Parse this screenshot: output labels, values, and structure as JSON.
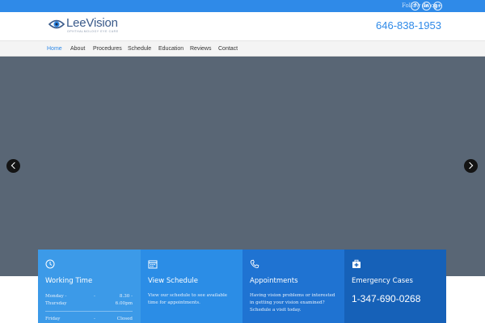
{
  "topbar": {
    "follow_label": "Follow us on:",
    "social": [
      {
        "icon": "facebook-icon",
        "glyph": "f"
      },
      {
        "icon": "linkedin-icon",
        "glyph": "in"
      },
      {
        "icon": "googleplus-icon",
        "glyph": "g+"
      }
    ]
  },
  "header": {
    "logo_name": "LeeVision",
    "logo_tagline": "OPHTHALMOLOGY EYE CARE",
    "phone": "646-838-1953"
  },
  "nav": {
    "items": [
      {
        "label": "Home",
        "active": true
      },
      {
        "label": "About"
      },
      {
        "label": "Procedures"
      },
      {
        "label": "Schedule"
      },
      {
        "label": "Education"
      },
      {
        "label": "Reviews"
      },
      {
        "label": "Contact"
      }
    ]
  },
  "slider": {
    "prev_icon": "chevron-left-icon",
    "next_icon": "chevron-right-icon"
  },
  "boxes": {
    "working_time": {
      "icon": "clock-icon",
      "title": "Working Time",
      "rows": [
        {
          "day": "Monday - Thursday",
          "dash": "-",
          "hours": "8.30 - 6.00pm"
        },
        {
          "day": "Friday",
          "dash": "-",
          "hours": "Closed"
        }
      ]
    },
    "schedule": {
      "icon": "calendar-icon",
      "title": "View Schedule",
      "desc": "View our schedule to see available time for appointments."
    },
    "appointments": {
      "icon": "phone-icon",
      "title": "Appointments",
      "desc": "Having vision problems or interested in getting your vision examined? Schedule a visit today."
    },
    "emergency": {
      "icon": "medical-kit-icon",
      "title": "Emergency Cases",
      "phone": "1-347-690-0268"
    }
  },
  "colors": {
    "topbar": "#2f8ae8",
    "accent": "#2f8ae8",
    "hero": "#596675",
    "box1": "#3c9ae8",
    "box2": "#2b8de6",
    "box3": "#1f73d2",
    "box4": "#1661b8"
  }
}
